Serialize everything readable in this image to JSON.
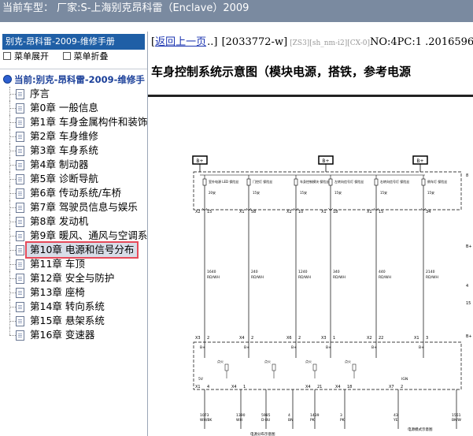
{
  "window": {
    "title": "当前车型： 厂家:S-上海别克昂科雷（Enclave）2009"
  },
  "sidebar": {
    "manual_title": "别克-昂科雷-2009-维修手册",
    "expand_label": "菜单展开",
    "collapse_label": "菜单折叠",
    "root_label": "当前:别克-昂科雷-2009-维修手",
    "chapters": [
      "序言",
      "第0章  一般信息",
      "第1章  车身金属构件和装饰",
      "第2章  车身维修",
      "第3章  车身系统",
      "第4章  制动器",
      "第5章  诊断导航",
      "第6章  传动系统/车桥",
      "第7章  驾驶员信息与娱乐",
      "第8章  发动机",
      "第9章  暖风、通风与空调系统",
      "第10章  电源和信号分布",
      "第11章  车顶",
      "第12章  安全与防护",
      "第13章  座椅",
      "第14章  转向系统",
      "第15章  悬架系统",
      "第16章  变速器"
    ],
    "selected_index": 11
  },
  "main": {
    "nav": {
      "back_link": "返回上一页",
      "sep_left": "[",
      "sep_right": "..]",
      "doc_id": "[2033772-w]",
      "tag": "[ZS3][sh_nm-i2][CX-0]",
      "meta": "NO:4PC:1 .2016596"
    },
    "page_title": "车身控制系统示意图（模块电源，搭铁，参考电源",
    "diagram": {
      "top_labels": [
        "B+",
        "B+",
        "B+"
      ],
      "fuses": [
        {
          "name": "室外电源 LED 保险丝",
          "rating": "20安"
        },
        {
          "name": "门控灯 保险丝",
          "rating": "15安"
        },
        {
          "name": "车身控制模块 保险丝",
          "rating": "15安"
        },
        {
          "name": "左转向信号灯 保险丝",
          "rating": "15安"
        },
        {
          "name": "右转向信号灯 保险丝",
          "rating": "15安"
        },
        {
          "name": "倒车灯 保险丝",
          "rating": "15安"
        }
      ],
      "upper_connectors": [
        {
          "conn": "X2",
          "pin": "15"
        },
        {
          "conn": "X1",
          "pin": "58"
        },
        {
          "conn": "X2",
          "pin": "10"
        },
        {
          "conn": "X1",
          "pin": "18"
        },
        {
          "conn": "X1",
          "pin": "15"
        },
        {
          "conn": "",
          "pin": "34"
        }
      ],
      "upper_wires": [
        {
          "gauge": "1640",
          "color": "RD/WH"
        },
        {
          "gauge": "240",
          "color": "RD/WH"
        },
        {
          "gauge": "1240",
          "color": "RD/WH"
        },
        {
          "gauge": "340",
          "color": "RD/WH"
        },
        {
          "gauge": "440",
          "color": "RD/WH"
        },
        {
          "gauge": "2140",
          "color": "RD/WH"
        }
      ],
      "mid_connectors": [
        {
          "conn": "X3",
          "pin": "2"
        },
        {
          "conn": "X4",
          "pin": "2"
        },
        {
          "conn": "X6",
          "pin": "2"
        },
        {
          "conn": "X3",
          "pin": "1"
        },
        {
          "conn": "X2",
          "pin": "22"
        },
        {
          "conn": "X1",
          "pin": "3"
        }
      ],
      "bplus_labels": [
        "B+",
        "B+",
        "B+",
        "B+",
        "B+",
        "B+"
      ],
      "switch_labels": [
        "点火",
        "点火",
        "点火",
        "点火"
      ],
      "input_labels": [
        "5V",
        "IGN"
      ],
      "lower_connectors": [
        {
          "conn": "X1",
          "pin": "4"
        },
        {
          "conn": "X4",
          "pin": "1"
        },
        {
          "conn": "",
          "pin": ""
        },
        {
          "conn": "X4",
          "pin": "21"
        },
        {
          "conn": "X4",
          "pin": "18"
        },
        {
          "conn": "X7",
          "pin": "2"
        }
      ],
      "lower_wires": [
        {
          "gauge": "1073",
          "color": "WH/BK"
        },
        {
          "gauge": "1390",
          "color": "WH"
        },
        {
          "gauge": "5985",
          "color": "D-BU"
        },
        {
          "gauge": "4",
          "color": "BN"
        },
        {
          "gauge": "1439",
          "color": "PK"
        },
        {
          "gauge": "3",
          "color": "PK"
        },
        {
          "gauge": "43",
          "color": "YE"
        },
        {
          "gauge": "1551",
          "color": "BK/W"
        }
      ],
      "footer_labels": [
        "电源分布示意图",
        "电源模式示意图"
      ],
      "right_labels": [
        "8",
        "B+",
        "4",
        "15",
        "B+"
      ]
    }
  }
}
